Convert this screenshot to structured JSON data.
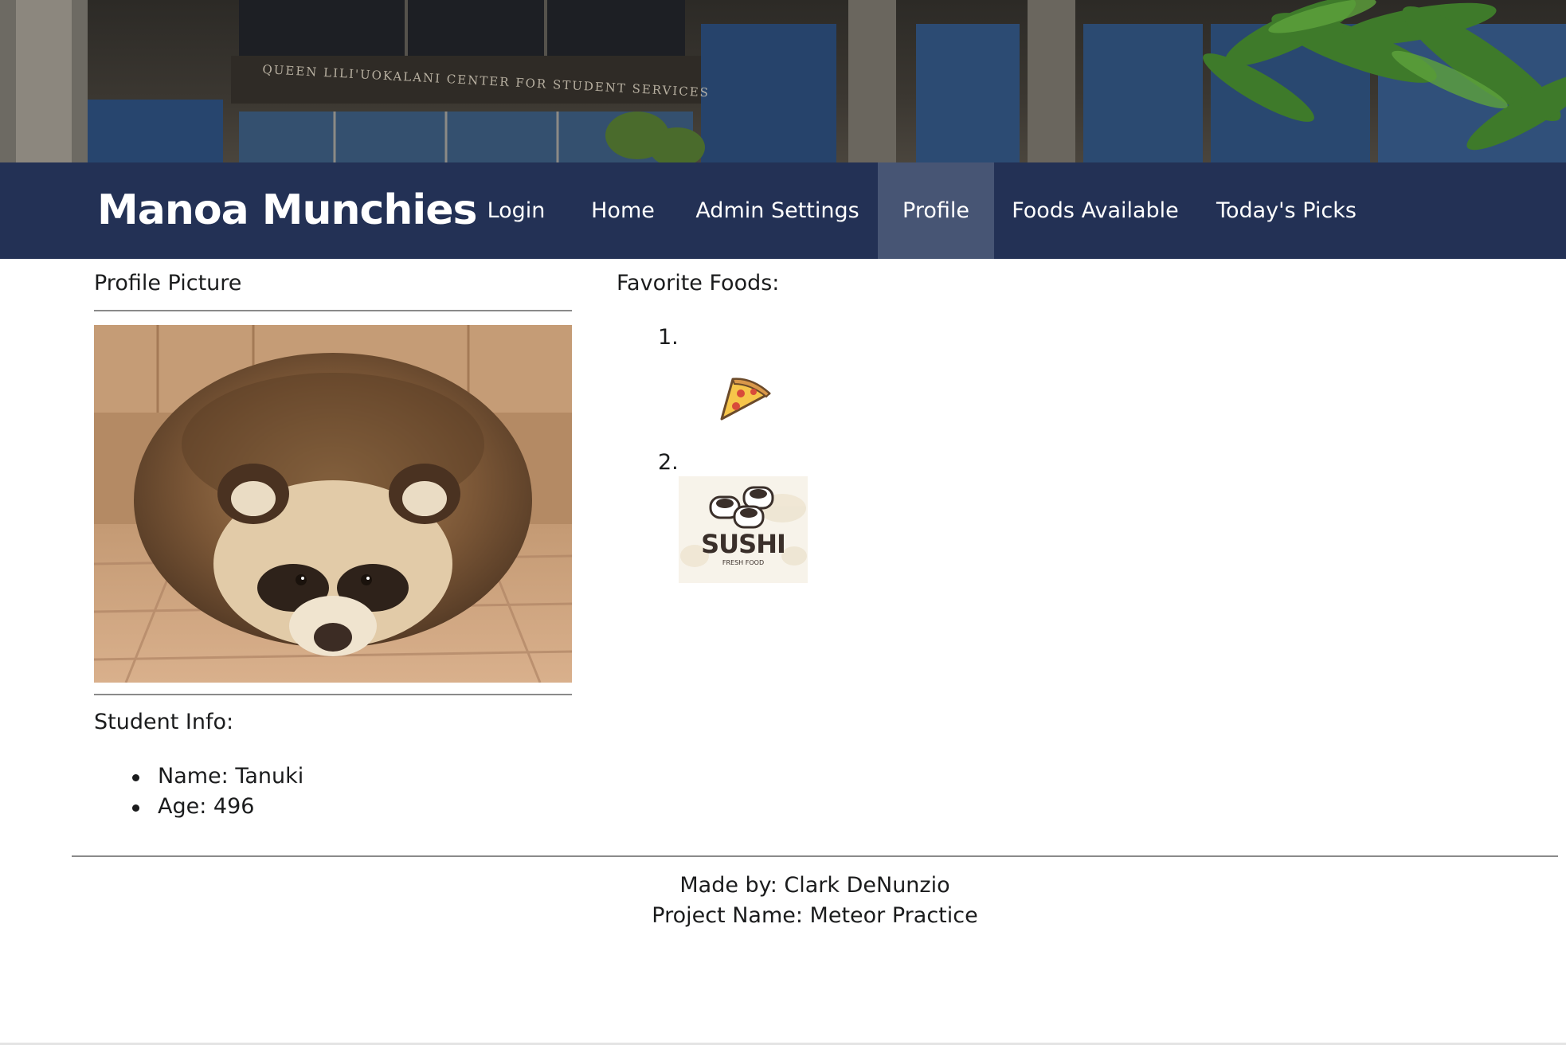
{
  "banner": {
    "sign_text": "QUEEN LILI'UOKALANI CENTER FOR STUDENT SERVICES"
  },
  "navbar": {
    "brand": "Manoa Munchies",
    "items": [
      {
        "label": "Login",
        "active": false
      },
      {
        "label": "Home",
        "active": false
      },
      {
        "label": "Admin Settings",
        "active": false
      },
      {
        "label": "Profile",
        "active": true
      },
      {
        "label": "Foods Available",
        "active": false
      },
      {
        "label": "Today's Picks",
        "active": false
      }
    ],
    "colors": {
      "background": "#233155",
      "active": "#475574",
      "text": "#ffffff"
    }
  },
  "profile": {
    "picture_heading": "Profile Picture",
    "picture_subject": "tanuki-photo",
    "student_info_heading": "Student Info:",
    "info": [
      {
        "text": "Name: Tanuki"
      },
      {
        "text": "Age: 496"
      }
    ]
  },
  "favorites": {
    "heading": "Favorite Foods:",
    "items": [
      {
        "number": "1.",
        "icon": "pizza-slice-icon"
      },
      {
        "number": "2.",
        "icon": "sushi-logo",
        "logo_text": "SUSHI",
        "logo_subtext": "FRESH FOOD"
      }
    ]
  },
  "footer": {
    "made_by": "Made by: Clark DeNunzio",
    "project": "Project Name: Meteor Practice"
  }
}
